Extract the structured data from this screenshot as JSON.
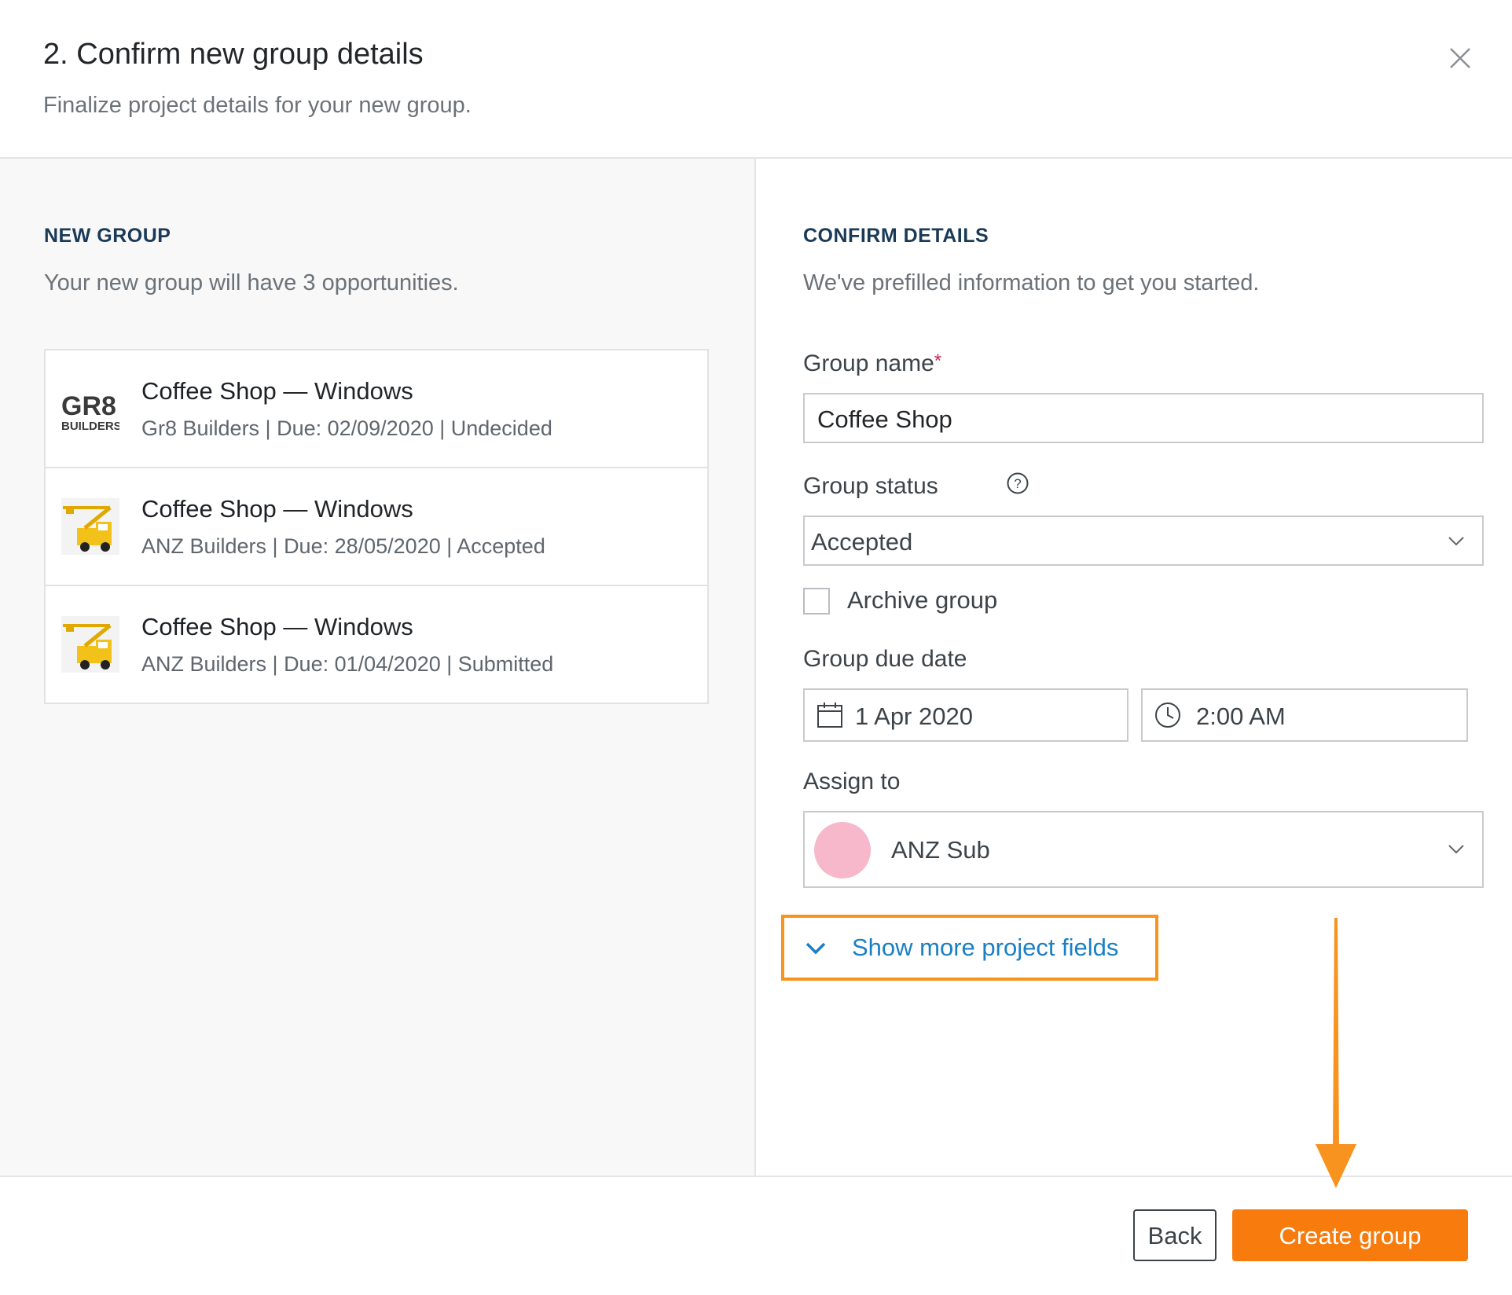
{
  "dialog": {
    "title": "2. Confirm new group details",
    "subtitle": "Finalize project details for your new group."
  },
  "new_group": {
    "heading": "NEW GROUP",
    "description": "Your new group will have 3 opportunities.",
    "opportunities": [
      {
        "name": "Coffee Shop",
        "trade": "— Windows",
        "meta": "Gr8 Builders | Due: 02/09/2020 | Undecided",
        "logo": "gr8-builders-logo",
        "logo_text_top": "GR8",
        "logo_text_bottom": "BUILDERS"
      },
      {
        "name": "Coffee Shop",
        "trade": "— Windows",
        "meta": "ANZ Builders | Due: 28/05/2020 | Accepted",
        "logo": "crane-truck-logo"
      },
      {
        "name": "Coffee Shop",
        "trade": "— Windows",
        "meta": "ANZ Builders | Due: 01/04/2020 | Submitted",
        "logo": "crane-truck-logo"
      }
    ]
  },
  "confirm": {
    "heading": "CONFIRM DETAILS",
    "description": "We've prefilled information to get you started.",
    "group_name_label": "Group name",
    "required_mark": "*",
    "group_name_value": "Coffee Shop",
    "group_status_label": "Group status",
    "group_status_value": "Accepted",
    "archive_label": "Archive group",
    "archive_checked": false,
    "due_date_label": "Group due date",
    "due_date_value": "1 Apr 2020",
    "due_time_value": "2:00 AM",
    "assign_label": "Assign to",
    "assign_value": "ANZ Sub",
    "show_more_label": "Show more project fields"
  },
  "footer": {
    "back_label": "Back",
    "create_label": "Create group"
  },
  "colors": {
    "primary_button": "#f77c0d",
    "link": "#1a7fc4",
    "highlight": "#f7931e",
    "avatar": "#f7b8cc",
    "heading": "#1a3a57"
  }
}
